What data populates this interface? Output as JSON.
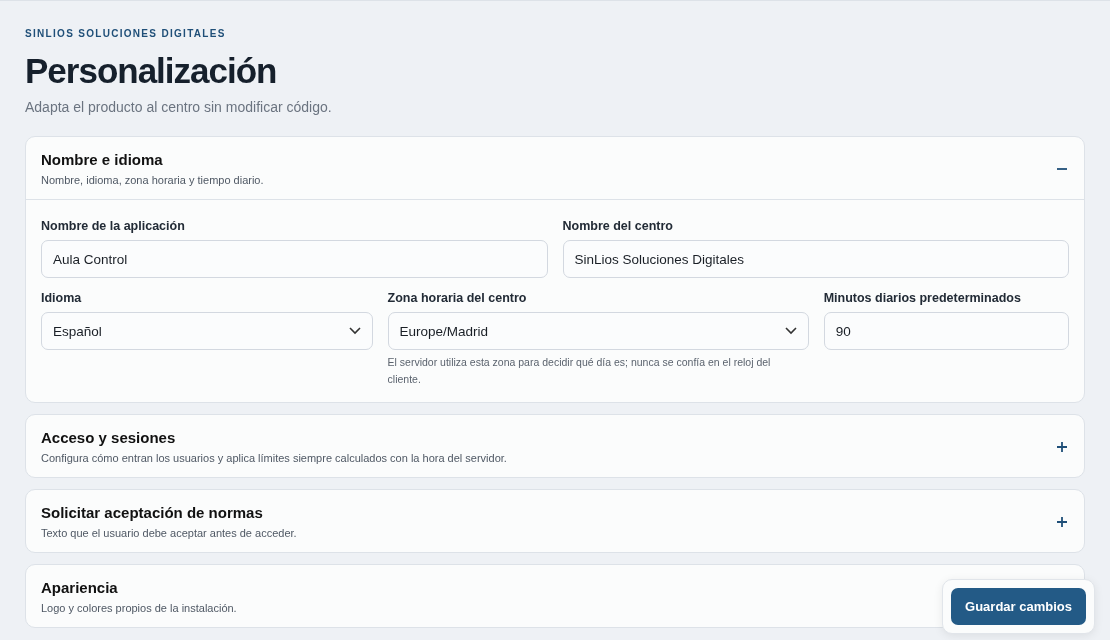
{
  "eyebrow": "SINLIOS SOLUCIONES DIGITALES",
  "title": "Personalización",
  "subtitle": "Adapta el producto al centro sin modificar código.",
  "sections": [
    {
      "title": "Nombre e idioma",
      "description": "Nombre, idioma, zona horaria y tiempo diario.",
      "expanded": true,
      "rows": [
        [
          {
            "label": "Nombre de la aplicación",
            "kind": "text",
            "value": "Aula Control"
          },
          {
            "label": "Nombre del centro",
            "kind": "text",
            "value": "SinLios Soluciones Digitales"
          }
        ],
        [
          {
            "label": "Idioma",
            "kind": "select",
            "value": "Español"
          },
          {
            "label": "Zona horaria del centro",
            "kind": "select",
            "value": "Europe/Madrid",
            "help": "El servidor utiliza esta zona para decidir qué día es; nunca se confía en el reloj del cliente."
          },
          {
            "label": "Minutos diarios predeterminados",
            "kind": "text",
            "value": "90"
          }
        ]
      ]
    },
    {
      "title": "Acceso y sesiones",
      "description": "Configura cómo entran los usuarios y aplica límites siempre calculados con la hora del servidor.",
      "expanded": false
    },
    {
      "title": "Solicitar aceptación de normas",
      "description": "Texto que el usuario debe aceptar antes de acceder.",
      "expanded": false
    },
    {
      "title": "Apariencia",
      "description": "Logo y colores propios de la instalación."
    }
  ],
  "save_button": "Guardar cambios"
}
